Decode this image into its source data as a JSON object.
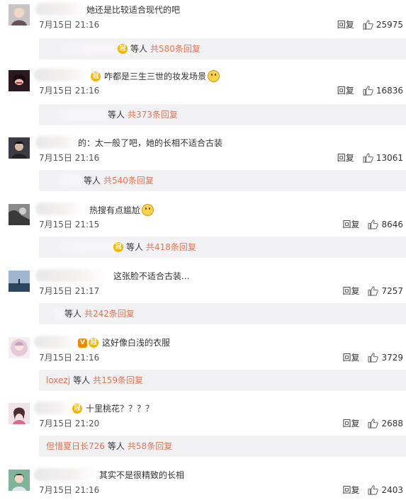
{
  "comments": [
    {
      "text": "她还是比较适合现代的吧",
      "badge": false,
      "vbadge": false,
      "emoji": false,
      "date": "7月15日 21:16",
      "reply": "回复",
      "likes": "25975",
      "sub_user": "",
      "sub_mid": "等人",
      "sub_total": "共580条回复",
      "sub_badge": true
    },
    {
      "text": "咋都是三生三世的妆发场景",
      "badge": true,
      "vbadge": false,
      "emoji": true,
      "date": "7月15日 21:16",
      "reply": "回复",
      "likes": "16836",
      "sub_user": "",
      "sub_mid": "等人",
      "sub_total": "共373条回复",
      "sub_badge": false
    },
    {
      "text": "的：太一般了吧，她的长相不适合古装",
      "badge": false,
      "vbadge": false,
      "emoji": false,
      "date": "7月15日 21:16",
      "reply": "回复",
      "likes": "13061",
      "sub_user": "",
      "sub_mid": "等人",
      "sub_total": "共540条回复",
      "sub_badge": false
    },
    {
      "text": "热搜有点尴尬",
      "badge": false,
      "vbadge": false,
      "emoji": true,
      "date": "7月15日 21:15",
      "reply": "回复",
      "likes": "8646",
      "sub_user": "",
      "sub_mid": "等人",
      "sub_total": "共418条回复",
      "sub_badge": true
    },
    {
      "text": "这张脸不适合古装...",
      "badge": false,
      "vbadge": false,
      "emoji": false,
      "date": "7月15日 21:17",
      "reply": "回复",
      "likes": "7257",
      "sub_user": "",
      "sub_mid": "等人",
      "sub_total": "共242条回复",
      "sub_badge": false
    },
    {
      "text": "这好像白浅的衣服",
      "badge": true,
      "vbadge": true,
      "emoji": false,
      "date": "7月15日 21:16",
      "reply": "回复",
      "likes": "3729",
      "sub_user": "loxezj",
      "sub_mid": "等人",
      "sub_total": "共159条回复",
      "sub_badge": false
    },
    {
      "text": "十里桃花？？？？",
      "badge": true,
      "vbadge": false,
      "emoji": false,
      "date": "7月15日 21:20",
      "reply": "回复",
      "likes": "2688",
      "sub_user": "但惜夏日长726",
      "sub_mid": "等人",
      "sub_total": "共58条回复",
      "sub_badge": false
    },
    {
      "text": "其实不是很精致的长相",
      "badge": false,
      "vbadge": false,
      "emoji": false,
      "date": "7月15日 21:16",
      "reply": "回复",
      "likes": "2403",
      "sub_user": "",
      "sub_mid": "",
      "sub_total": "",
      "sub_badge": false
    }
  ],
  "colors": {
    "accent": "#eb7350",
    "sub_bg": "#f2f2f5",
    "badge": "#f7b500"
  },
  "icons": {
    "like": "thumbs-up-icon",
    "badge": "vip-crown-icon",
    "emoji": "smiley-emoji-icon"
  }
}
